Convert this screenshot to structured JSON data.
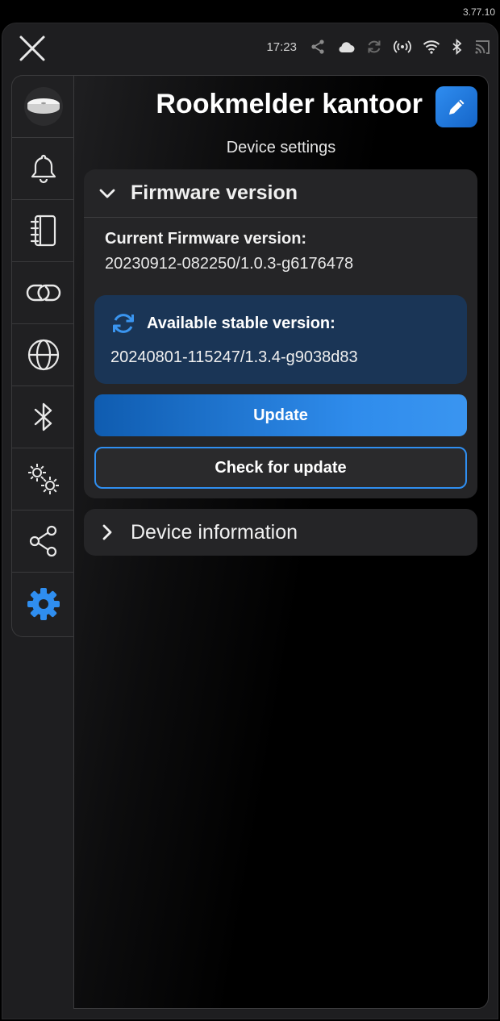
{
  "app": {
    "version": "3.77.10"
  },
  "status_bar": {
    "time": "17:23",
    "icons": [
      "share-icon",
      "cloud-icon",
      "sync-icon",
      "broadcast-icon",
      "wifi-icon",
      "bluetooth-icon",
      "cast-icon"
    ]
  },
  "header": {
    "title": "Rookmelder kantoor",
    "subtitle": "Device settings"
  },
  "sidebar": {
    "items": [
      {
        "icon": "smoke-detector-icon",
        "active": false
      },
      {
        "icon": "bell-icon",
        "active": false
      },
      {
        "icon": "notebook-icon",
        "active": false
      },
      {
        "icon": "link-icon",
        "active": false
      },
      {
        "icon": "globe-icon",
        "active": false
      },
      {
        "icon": "bluetooth-icon",
        "active": false
      },
      {
        "icon": "gears-icon",
        "active": false
      },
      {
        "icon": "share-icon",
        "active": false
      },
      {
        "icon": "settings-gear-icon",
        "active": true
      }
    ]
  },
  "firmware": {
    "header": "Firmware version",
    "current_label": "Current Firmware version:",
    "current_value": "20230912-082250/1.0.3-g6176478",
    "available_label": "Available stable version:",
    "available_value": "20240801-115247/1.3.4-g9038d83",
    "update_label": "Update",
    "check_label": "Check for update"
  },
  "device_info": {
    "header": "Device information"
  },
  "colors": {
    "accent": "#2f8ef0",
    "available_bg": "#1a3556",
    "background": "#000000"
  }
}
